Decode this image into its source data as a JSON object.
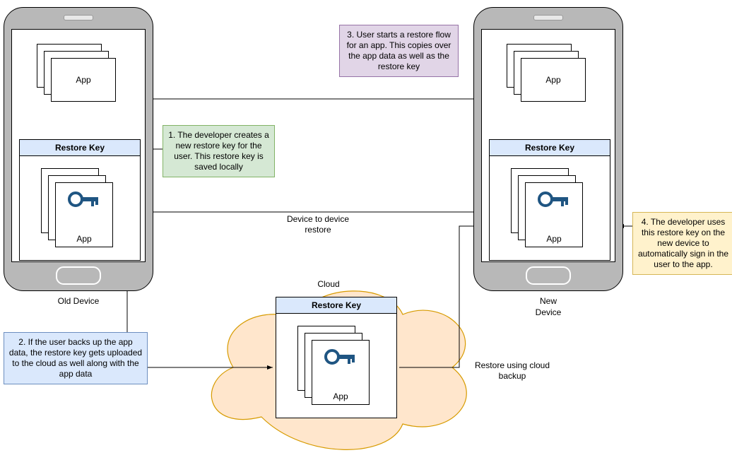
{
  "devices": {
    "old": {
      "label": "Old Device"
    },
    "new": {
      "label": "New\nDevice"
    }
  },
  "labels": {
    "app": "App",
    "restore_key": "Restore Key",
    "cloud": "Cloud",
    "d2d": "Device to device\nrestore",
    "cloud_restore": "Restore using cloud\nbackup"
  },
  "callouts": {
    "c1": {
      "text": "1. The developer creates a new restore key for the user. This restore key is saved locally"
    },
    "c2": {
      "text": "2. If the user backs up the app data, the restore key gets uploaded to the cloud as well along with the app data"
    },
    "c3": {
      "text": "3. User starts a restore flow for an app. This copies over the app data as well as the restore key"
    },
    "c4": {
      "text": "4. The developer uses this restore key on the new device to automatically sign in the user to the app."
    }
  },
  "colors": {
    "c1_bg": "#d5e8d4",
    "c1_br": "#82b366",
    "c2_bg": "#dae8fc",
    "c2_br": "#6c8ebf",
    "c3_bg": "#e1d5e7",
    "c3_br": "#9673a6",
    "c4_bg": "#fff2cc",
    "c4_br": "#d6b656",
    "cloud_bg": "#ffe6cc",
    "cloud_br": "#d79b00",
    "header_bg": "#dae8fc",
    "key": "#1f5582"
  }
}
